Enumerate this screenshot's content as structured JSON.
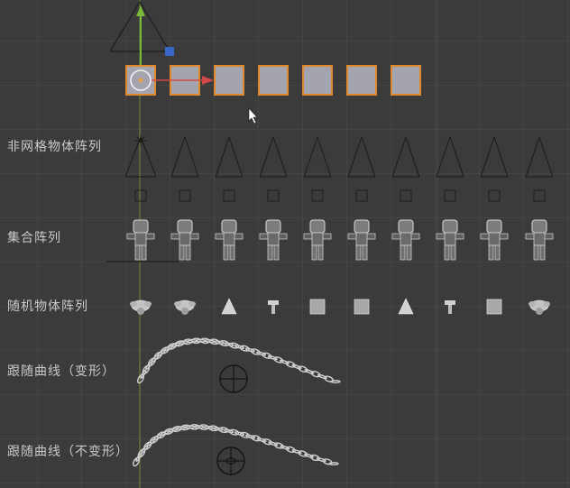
{
  "rows": [
    {
      "label": "非网格物体阵列"
    },
    {
      "label": "集合阵列"
    },
    {
      "label": "随机物体阵列"
    },
    {
      "label": "跟随曲线（变形）"
    },
    {
      "label": "跟随曲线（不变形）"
    }
  ],
  "colors": {
    "background": "#3b3b3b",
    "grid": "#444444",
    "selected_outline": "#e0892c",
    "cube_fill": "#a4a4ae",
    "x_axis": "#d04a4a",
    "y_axis": "#7ab83a",
    "gizmo_handle": "#3a66c8"
  },
  "mesh_array": {
    "count": 7
  },
  "camera_array": {
    "count": 10
  },
  "collection_array": {
    "count": 10
  },
  "random_objects": [
    "monkey-icon",
    "monkey-icon",
    "cone-icon",
    "hammer-icon",
    "cube-icon",
    "cube-icon",
    "cone-icon",
    "hammer-icon",
    "cube-icon",
    "monkey-icon"
  ]
}
